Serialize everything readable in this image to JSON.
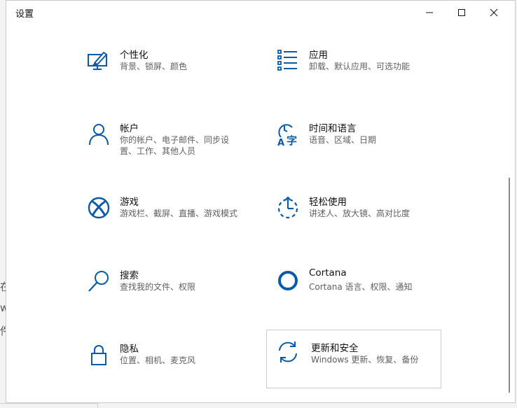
{
  "window": {
    "title": "设置",
    "controls": {
      "minimize": "minimize-icon",
      "maximize": "maximize-icon",
      "close": "close-icon"
    }
  },
  "background_glyphs": [
    "在",
    "w",
    "件"
  ],
  "tiles": [
    {
      "title": "个性化",
      "desc": "背景、锁屏、颜色",
      "icon": "personalization-icon"
    },
    {
      "title": "应用",
      "desc": "卸载、默认应用、可选功能",
      "icon": "apps-icon"
    },
    {
      "title": "帐户",
      "desc": "你的帐户、电子邮件、同步设置、工作、其他人员",
      "icon": "accounts-icon"
    },
    {
      "title": "时间和语言",
      "desc": "语音、区域、日期",
      "icon": "time-language-icon"
    },
    {
      "title": "游戏",
      "desc": "游戏栏、截屏、直播、游戏模式",
      "icon": "xbox-icon"
    },
    {
      "title": "轻松使用",
      "desc": "讲述人、放大镜、高对比度",
      "icon": "ease-of-access-icon"
    },
    {
      "title": "搜索",
      "desc": "查找我的文件、权限",
      "icon": "search-icon"
    },
    {
      "title": "Cortana",
      "desc": "Cortana 语言、权限、通知",
      "icon": "cortana-icon"
    },
    {
      "title": "隐私",
      "desc": "位置、相机、麦克风",
      "icon": "lock-icon"
    },
    {
      "title": "更新和安全",
      "desc": "Windows 更新、恢复、备份",
      "icon": "update-icon"
    }
  ],
  "colors": {
    "accent": "#0a5aa5",
    "title_text": "#111111",
    "desc_text": "#5f5f5f"
  }
}
